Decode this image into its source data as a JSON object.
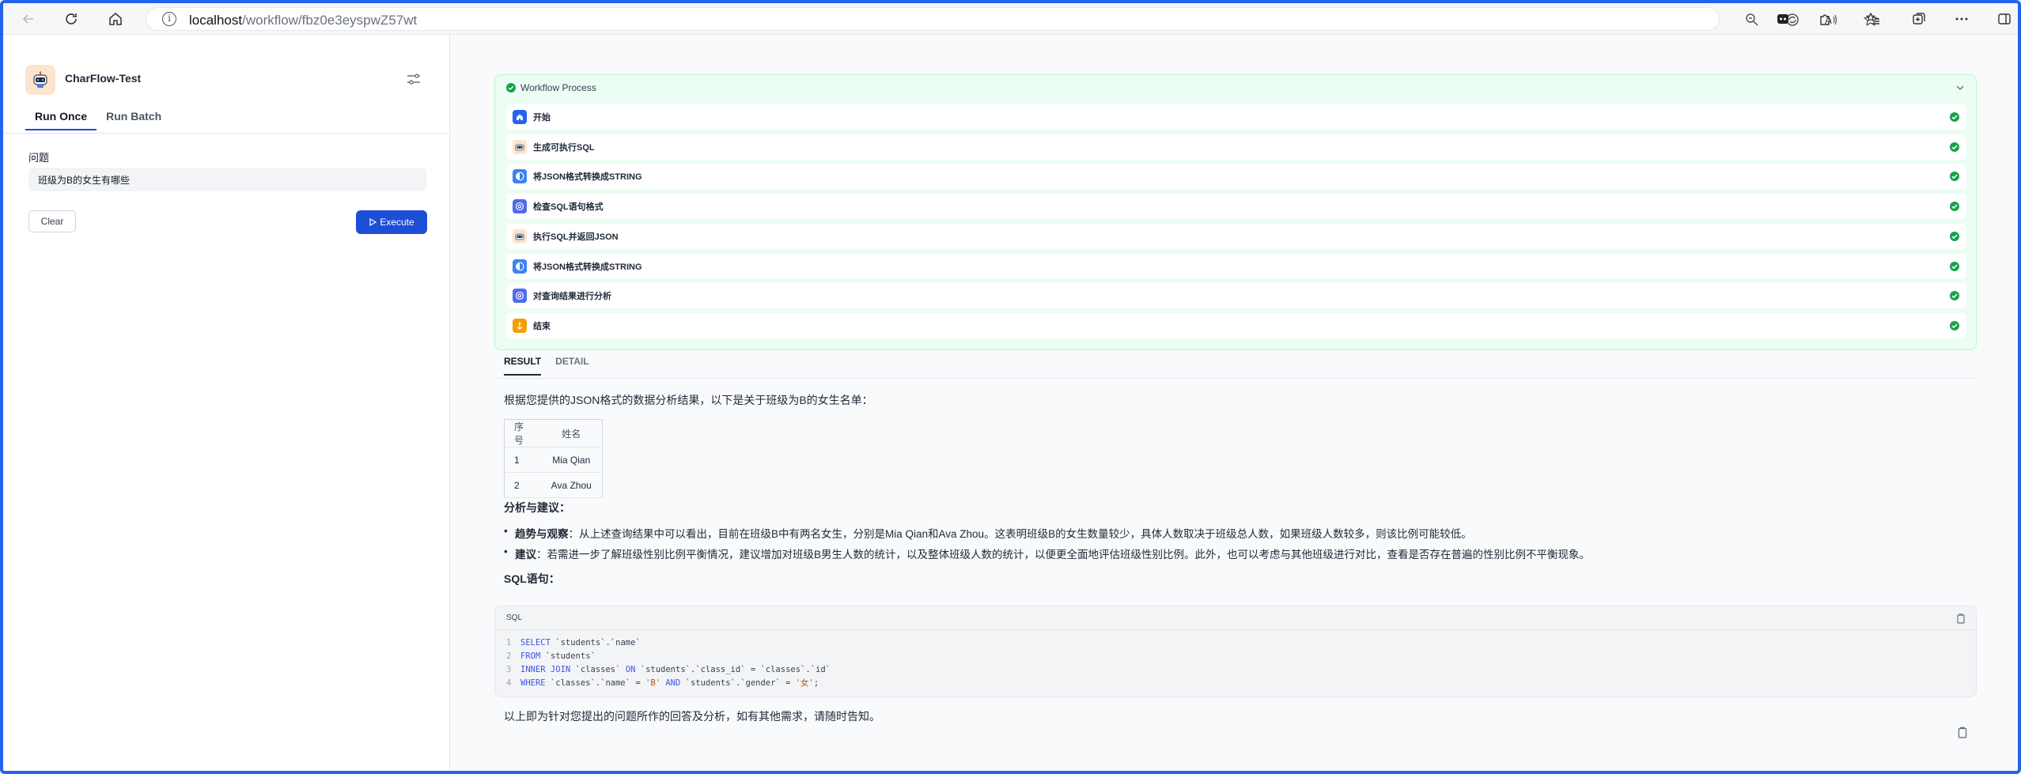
{
  "browser": {
    "url_host": "localhost",
    "url_path": "/workflow/fbz0e3eyspwZ57wt"
  },
  "app": {
    "title": "CharFlow-Test",
    "tabs": [
      {
        "label": "Run Once"
      },
      {
        "label": "Run Batch"
      }
    ],
    "question_label": "问题",
    "question_value": "班级为B的女生有哪些",
    "clear_label": "Clear",
    "execute_label": "Execute"
  },
  "workflow": {
    "header": "Workflow Process",
    "nodes": [
      {
        "label": "开始",
        "icon": "home-icon",
        "color": "#2563eb"
      },
      {
        "label": "生成可执行SQL",
        "icon": "robot-icon",
        "color": "#fde4cf"
      },
      {
        "label": "将JSON格式转换成STRING",
        "icon": "code-icon",
        "color": "#3b82f6"
      },
      {
        "label": "检查SQL语句格式",
        "icon": "at-icon",
        "color": "#4f6bea"
      },
      {
        "label": "执行SQL并返回JSON",
        "icon": "robot-icon",
        "color": "#fde4cf"
      },
      {
        "label": "将JSON格式转换成STRING",
        "icon": "code-icon",
        "color": "#3b82f6"
      },
      {
        "label": "对查询结果进行分析",
        "icon": "at-icon",
        "color": "#4f6bea"
      },
      {
        "label": "结束",
        "icon": "flag-icon",
        "color": "#f59e0b"
      }
    ]
  },
  "result": {
    "tabs": [
      {
        "label": "RESULT"
      },
      {
        "label": "DETAIL"
      }
    ],
    "intro": "根据您提供的JSON格式的数据分析结果，以下是关于班级为B的女生名单：",
    "table": {
      "headers": [
        "序号",
        "姓名"
      ],
      "rows": [
        [
          "1",
          "Mia Qian"
        ],
        [
          "2",
          "Ava Zhou"
        ]
      ]
    },
    "analysis_heading": "分析与建议：",
    "bullets": [
      {
        "bold": "趋势与观察",
        "text": "：从上述查询结果中可以看出，目前在班级B中有两名女生，分别是Mia Qian和Ava Zhou。这表明班级B的女生数量较少，具体人数取决于班级总人数，如果班级人数较多，则该比例可能较低。"
      },
      {
        "bold": "建议",
        "text": "：若需进一步了解班级性别比例平衡情况，建议增加对班级B男生人数的统计，以及整体班级人数的统计，以便更全面地评估班级性别比例。此外，也可以考虑与其他班级进行对比，查看是否存在普遍的性别比例不平衡现象。"
      }
    ],
    "sql_heading": "SQL语句：",
    "code_lang": "SQL",
    "code_lines": [
      {
        "n": "1",
        "kw": "SELECT",
        "rest": " `students`.`name`"
      },
      {
        "n": "2",
        "kw": "FROM",
        "rest": " `students`"
      },
      {
        "n": "3",
        "kw": "INNER JOIN",
        "rest": " `classes` ",
        "kw2": "ON",
        "rest2": " `students`.`class_id` = `classes`.`id`"
      },
      {
        "n": "4",
        "kw": "WHERE",
        "rest": " `classes`.`name` = ",
        "str": "'B'",
        "kw3": " AND",
        "rest3": " `students`.`gender` = ",
        "str2": "'女'",
        "end": ";"
      }
    ],
    "outro": "以上即为针对您提出的问题所作的回答及分析，如有其他需求，请随时告知。"
  }
}
